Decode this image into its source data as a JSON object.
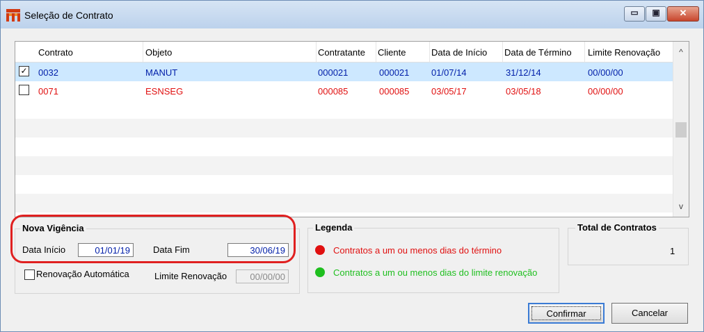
{
  "window": {
    "title": "Seleção de Contrato",
    "minimize": "▭",
    "maximize": "▣",
    "close": "✕"
  },
  "grid": {
    "columns": [
      "Contrato",
      "Objeto",
      "Contratante",
      "Cliente",
      "Data de Início",
      "Data de Término",
      "Limite Renovação"
    ],
    "rows": [
      {
        "checked": "✓",
        "contrato": "0032",
        "objeto": "MANUT",
        "contratante": "000021",
        "cliente": "000021",
        "inicio": "01/07/14",
        "termino": "31/12/14",
        "limite": "00/00/00"
      },
      {
        "checked": "",
        "contrato": "0071",
        "objeto": "ESNSEG",
        "contratante": "000085",
        "cliente": "000085",
        "inicio": "03/05/17",
        "termino": "03/05/18",
        "limite": "00/00/00"
      }
    ],
    "scroll_up": "^",
    "scroll_down": "v"
  },
  "nova_vigencia": {
    "title": "Nova Vigência",
    "data_inicio_label": "Data Início",
    "data_inicio_value": "01/01/19",
    "data_fim_label": "Data Fim",
    "data_fim_value": "30/06/19",
    "renovacao_label": "Renovação Automática",
    "limite_label": "Limite Renovação",
    "limite_value": "00/00/00"
  },
  "legenda": {
    "title": "Legenda",
    "items": [
      {
        "text": "Contratos a um ou menos dias do término",
        "color": "#e01010"
      },
      {
        "text": "Contratos a um ou menos dias do limite renovação",
        "color": "#1fbf1f"
      }
    ]
  },
  "total": {
    "title": "Total de Contratos",
    "value": "1"
  },
  "buttons": {
    "confirmar": "Confirmar",
    "cancelar": "Cancelar"
  },
  "colors": {
    "selected_row": "#cde8ff",
    "text_blue": "#001ea8",
    "text_red": "#e01010",
    "highlight": "#e02020"
  }
}
